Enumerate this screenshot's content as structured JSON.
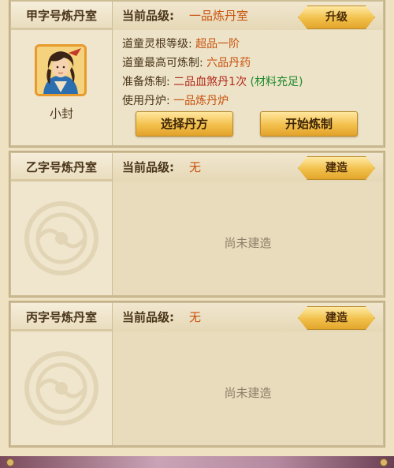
{
  "rooms": [
    {
      "name": "甲字号炼丹室",
      "level_label": "当前品级:",
      "level_value": "一品炼丹室",
      "button": "升级",
      "alchemist": {
        "name": "小封",
        "rows": [
          {
            "label": "道童灵根等级:",
            "value": "超品一阶"
          },
          {
            "label": "道童最高可炼制:",
            "value": "六品丹药"
          },
          {
            "label": "准备炼制:",
            "value": "二品血煞丹1次",
            "extra": "(材料充足)"
          },
          {
            "label": "使用丹炉:",
            "value": "一品炼丹炉"
          }
        ],
        "actions": {
          "select": "选择丹方",
          "start": "开始炼制"
        }
      }
    },
    {
      "name": "乙字号炼丹室",
      "level_label": "当前品级:",
      "level_value": "无",
      "button": "建造",
      "status": "尚未建造"
    },
    {
      "name": "丙字号炼丹室",
      "level_label": "当前品级:",
      "level_value": "无",
      "button": "建造",
      "status": "尚未建造"
    }
  ],
  "colors": {
    "accent_value": "#c8520d",
    "pill_red": "#b22b1b",
    "ok_green": "#1d8a2b",
    "button_gold": "#f1c04a"
  }
}
